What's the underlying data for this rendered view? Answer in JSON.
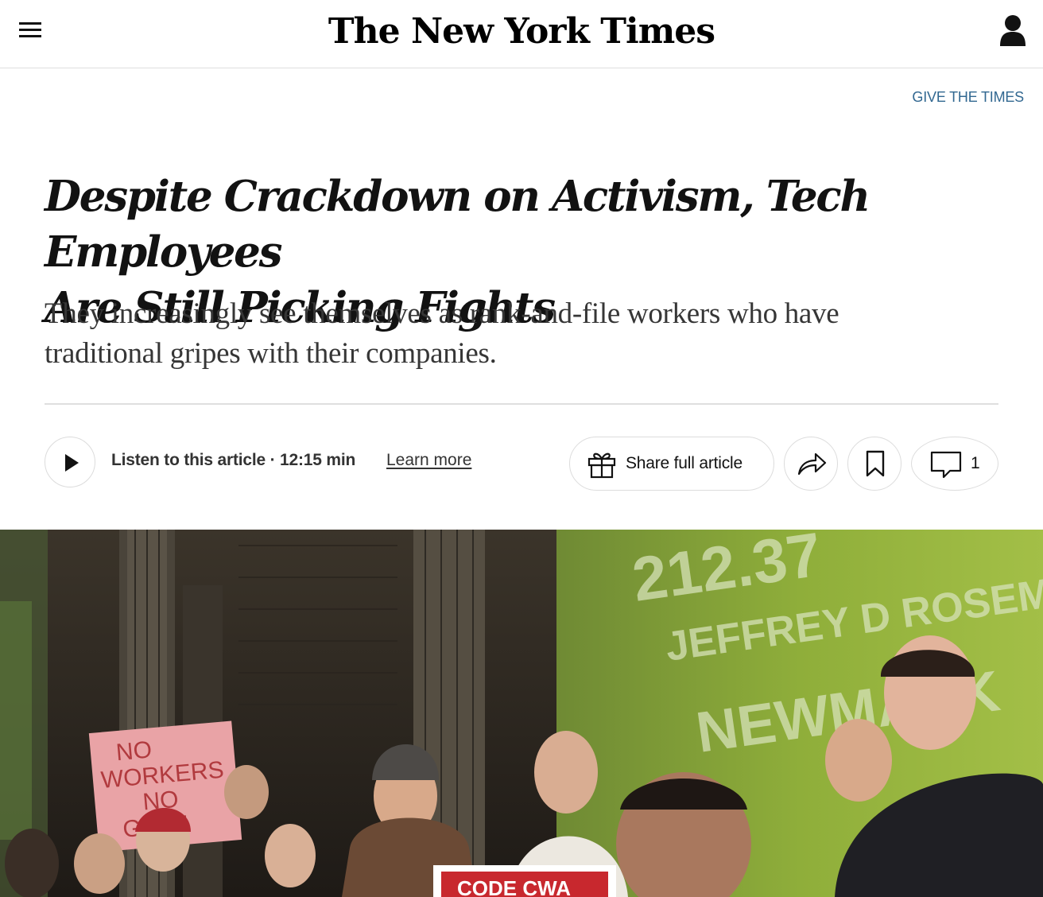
{
  "masthead": {
    "logo_text": "The New York Times",
    "menu_icon": "hamburger-menu-icon",
    "account_icon": "user-account-icon"
  },
  "give_link": "GIVE THE TIMES",
  "article": {
    "headline_line1": "Despite Crackdown on Activism, Tech Employees",
    "headline_line2": "Are Still Picking Fights",
    "summary_line1": "They increasingly see themselves as rank-and-file workers who have",
    "summary_line2": "traditional gripes with their companies."
  },
  "toolbar": {
    "listen_label": "Listen to this article · 12:15 min",
    "learn_more": "Learn more",
    "share_full": "Share full article",
    "comment_count": "1",
    "icons": [
      "play-icon",
      "gift-icon",
      "share-arrow-icon",
      "bookmark-icon",
      "comment-icon"
    ]
  },
  "photo": {
    "wall_number": "212.37",
    "wall_name": "JEFFREY D ROSEM",
    "wall_brand": "NEWMARK",
    "sign_text": [
      "NO",
      "WORKERS",
      "NO",
      "GIGVI"
    ],
    "banner_text": "CODE CWA"
  },
  "colors": {
    "link_blue": "#326891",
    "border_gray": "#dfdfdf",
    "text_dark": "#121212"
  }
}
